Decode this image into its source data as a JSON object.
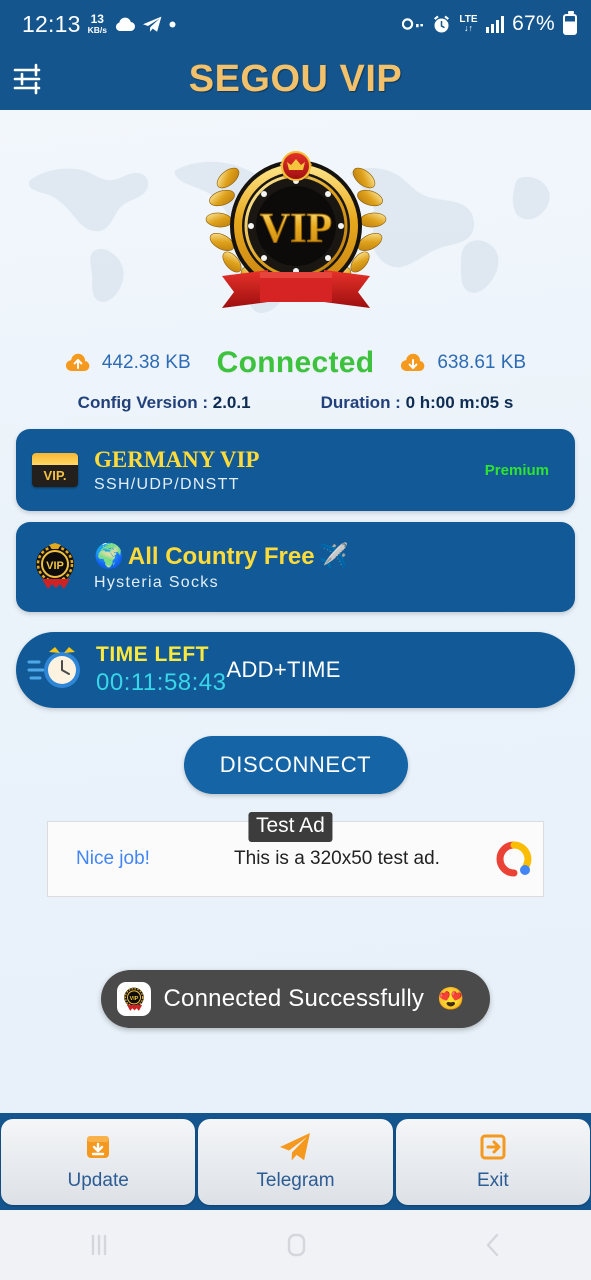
{
  "status_bar": {
    "time": "12:13",
    "net_rate_value": "13",
    "net_rate_unit": "KB/s",
    "battery_percent": "67%",
    "network_type": "LTE",
    "icons": [
      "cloud-icon",
      "telegram-icon",
      "dot-icon",
      "vpn-key-icon",
      "alarm-icon",
      "lte-icon",
      "signal-bars-icon",
      "battery-icon"
    ]
  },
  "app_bar": {
    "title": "SEGOU VIP",
    "menu_icon": "tune-icon"
  },
  "hero": {
    "logo_text": "VIP",
    "logo_name": "vip-badge-logo"
  },
  "stats": {
    "upload_value": "442.38 KB",
    "status": "Connected",
    "download_value": "638.61 KB",
    "config_version_label": "Config Version :",
    "config_version_value": "2.0.1",
    "duration_label": "Duration :",
    "duration_value": "0 h:00 m:05 s"
  },
  "servers": [
    {
      "title": "GERMANY VIP",
      "subtitle": "SSH/UDP/DNSTT",
      "badge": "Premium",
      "icon": "vip-card-icon"
    },
    {
      "title": "All Country Free",
      "title_emoji_left": "🌍",
      "title_emoji_right": "✈️",
      "subtitle": "Hysteria Socks",
      "badge": "",
      "icon": "vip-medal-icon"
    }
  ],
  "time_card": {
    "label": "TIME LEFT",
    "value": "00:11:58:43",
    "action": "ADD+TIME",
    "icon": "alarm-clock-icon"
  },
  "primary_action": {
    "label": "DISCONNECT"
  },
  "ad": {
    "headline": "Nice job!",
    "body": "This is a 320x50 test ad.",
    "badge": "Test Ad",
    "logo": "admob-icon"
  },
  "toast": {
    "message": "Connected Successfully",
    "emoji": "😍",
    "icon": "app-vip-icon"
  },
  "bottom_nav": [
    {
      "label": "Update",
      "icon": "download-box-icon"
    },
    {
      "label": "Telegram",
      "icon": "paper-plane-icon"
    },
    {
      "label": "Exit",
      "icon": "exit-arrow-icon"
    }
  ],
  "android_nav": [
    {
      "icon": "recents-icon"
    },
    {
      "icon": "home-icon"
    },
    {
      "icon": "back-icon"
    }
  ],
  "colors": {
    "brand_blue": "#14558e",
    "card_blue": "#115a97",
    "accent_gold": "#f3c16a",
    "connected_green": "#3cc23c",
    "premium_green": "#2fe42f",
    "time_yellow": "#ffe93c",
    "time_cyan": "#38d6e8",
    "orange": "#f59a1e"
  }
}
